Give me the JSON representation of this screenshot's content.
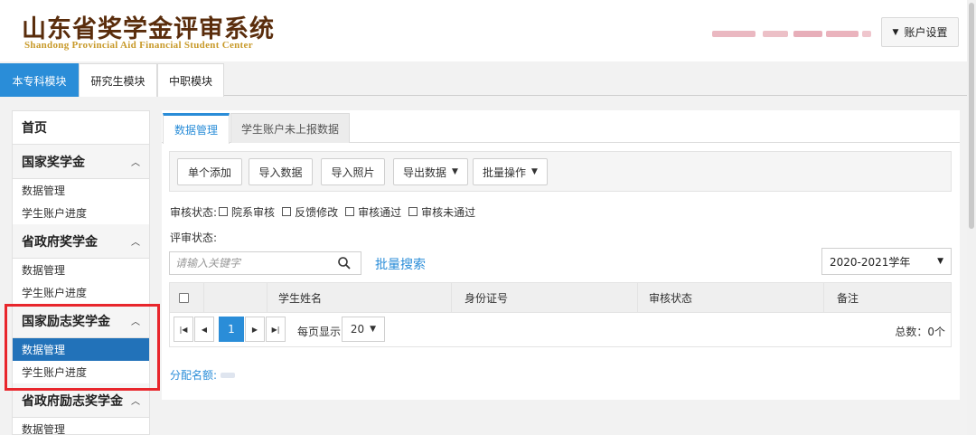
{
  "header": {
    "title": "山东省奖学金评审系统",
    "subtitle": "Shandong Provincial Aid Financial Student Center",
    "account_button": "账户设置"
  },
  "module_tabs": [
    {
      "label": "本专科模块",
      "active": true
    },
    {
      "label": "研究生模块",
      "active": false
    },
    {
      "label": "中职模块",
      "active": false
    }
  ],
  "sidebar": {
    "home": "首页",
    "groups": [
      {
        "title": "国家奖学金",
        "items": [
          "数据管理",
          "学生账户进度"
        ]
      },
      {
        "title": "省政府奖学金",
        "items": [
          "数据管理",
          "学生账户进度"
        ]
      },
      {
        "title": "国家励志奖学金",
        "items": [
          "数据管理",
          "学生账户进度"
        ],
        "active_item": "数据管理"
      },
      {
        "title": "省政府励志奖学金",
        "items": [
          "数据管理"
        ]
      }
    ]
  },
  "panel_tabs": [
    {
      "label": "数据管理",
      "active": true
    },
    {
      "label": "学生账户未上报数据",
      "active": false
    }
  ],
  "toolbar": {
    "add_single": "单个添加",
    "import_data": "导入数据",
    "import_photos": "导入照片",
    "export_data": "导出数据",
    "batch_ops": "批量操作"
  },
  "filters": {
    "audit_status_label": "审核状态:",
    "options": [
      "院系审核",
      "反馈修改",
      "审核通过",
      "审核未通过"
    ],
    "review_status_label": "评审状态:"
  },
  "search": {
    "placeholder": "请输入关键字",
    "batch_search": "批量搜索"
  },
  "year_select": {
    "selected": "2020-2021学年"
  },
  "table": {
    "columns": [
      "",
      "",
      "学生姓名",
      "身份证号",
      "审核状态",
      "备注"
    ],
    "rows": []
  },
  "pager": {
    "current_page": "1",
    "per_page_label": "每页显示",
    "per_page": "20",
    "total": "总数：0个"
  },
  "quota_label": "分配名额:",
  "colors": {
    "accent": "#2a8dd8",
    "sidebar_active": "#2272b9",
    "highlight_box": "#e8262c",
    "title": "#5a2d0c",
    "subtitle": "#c89a2a"
  }
}
